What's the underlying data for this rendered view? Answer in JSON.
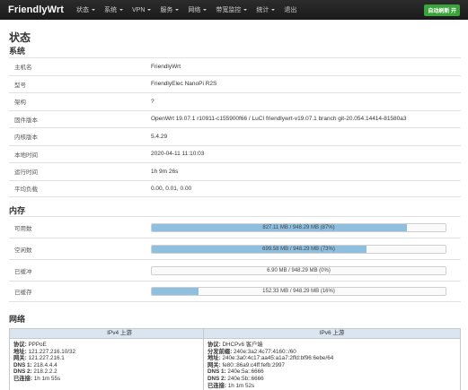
{
  "navbar": {
    "brand": "FriendlyWrt",
    "menu": [
      {
        "label": "状态",
        "dropdown": true
      },
      {
        "label": "系统",
        "dropdown": true
      },
      {
        "label": "VPN",
        "dropdown": true
      },
      {
        "label": "服务",
        "dropdown": true
      },
      {
        "label": "网络",
        "dropdown": true
      },
      {
        "label": "带宽监控",
        "dropdown": true
      },
      {
        "label": "统计",
        "dropdown": true
      },
      {
        "label": "退出",
        "dropdown": false
      }
    ],
    "refresh_label": "自动刷新 开"
  },
  "page_title": "状态",
  "system": {
    "title": "系统",
    "rows": [
      {
        "key": "主机名",
        "value": "FriendlyWrt"
      },
      {
        "key": "型号",
        "value": "FriendlyElec NanoPi R2S"
      },
      {
        "key": "架构",
        "value": "?"
      },
      {
        "key": "固件版本",
        "value": "OpenWrt 19.07.1 r10911-c155900f66 / LuCI friendlywrt-v19.07.1 branch git-20.054.14414-81580a3"
      },
      {
        "key": "内核版本",
        "value": "5.4.29"
      },
      {
        "key": "本地时间",
        "value": "2020-04-11 11:10:03"
      },
      {
        "key": "运行时间",
        "value": "1h 9m 26s"
      },
      {
        "key": "平均负载",
        "value": "0.00, 0.01, 0.00"
      }
    ]
  },
  "memory": {
    "title": "内存",
    "rows": [
      {
        "key": "可用数",
        "text": "827.11 MB / 948.29 MB (87%)",
        "fraction": 0.87
      },
      {
        "key": "空闲数",
        "text": "699.58 MB / 948.29 MB (73%)",
        "fraction": 0.73
      },
      {
        "key": "已缓冲",
        "text": "6.90 MB / 948.29 MB (0%)",
        "fraction": 0.0
      },
      {
        "key": "已缓存",
        "text": "152.33 MB / 948.29 MB (16%)",
        "fraction": 0.16
      }
    ]
  },
  "network": {
    "title": "网络",
    "ipv4": {
      "header": "IPv4 上游",
      "lines": [
        {
          "label": "协议:",
          "value": "PPPoE"
        },
        {
          "label": "地址:",
          "value": "121.227.216.10/32"
        },
        {
          "label": "网关:",
          "value": "121.227.216.1"
        },
        {
          "label": "DNS 1:",
          "value": "218.4.4.4"
        },
        {
          "label": "DNS 2:",
          "value": "218.2.2.2"
        },
        {
          "label": "已连接:",
          "value": "1h 1m 55s"
        }
      ]
    },
    "ipv6": {
      "header": "IPv6 上游",
      "lines": [
        {
          "label": "协议:",
          "value": "DHCPv6 客户端"
        },
        {
          "label": "分发前缀:",
          "value": "240e:3a2:4c77:4160::/60"
        },
        {
          "label": "地址:",
          "value": "240e:3a0:4c17:aa45:a1a7:2ffd:bf96:6ebe/64"
        },
        {
          "label": "网关:",
          "value": "fe80::86a9:c4ff:fefb:2997"
        },
        {
          "label": "DNS 1:",
          "value": "240e:5a::6666"
        },
        {
          "label": "DNS 2:",
          "value": "240e:5b::6666"
        },
        {
          "label": "已连接:",
          "value": "1h 1m 52s"
        }
      ]
    }
  }
}
